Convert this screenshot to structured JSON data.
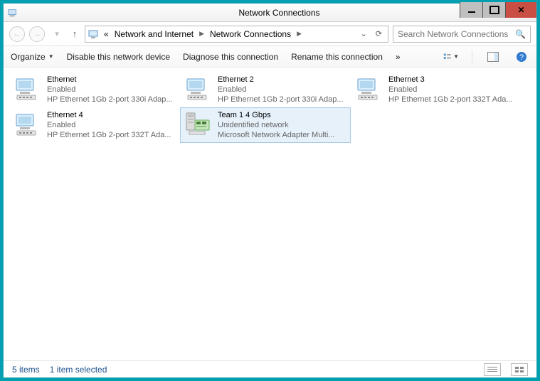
{
  "window": {
    "title": "Network Connections"
  },
  "breadcrumb": {
    "prefix": "«",
    "parts": [
      "Network and Internet",
      "Network Connections"
    ]
  },
  "search": {
    "placeholder": "Search Network Connections"
  },
  "toolbar": {
    "organize": "Organize",
    "disable": "Disable this network device",
    "diagnose": "Diagnose this connection",
    "rename": "Rename this connection",
    "more": "»"
  },
  "items": [
    {
      "name": "Ethernet",
      "status": "Enabled",
      "desc": "HP Ethernet 1Gb 2-port 330i Adap...",
      "selected": false,
      "type": "nic"
    },
    {
      "name": "Ethernet 2",
      "status": "Enabled",
      "desc": "HP Ethernet 1Gb 2-port 330i Adap...",
      "selected": false,
      "type": "nic"
    },
    {
      "name": "Ethernet 3",
      "status": "Enabled",
      "desc": "HP Ethernet 1Gb 2-port 332T Ada...",
      "selected": false,
      "type": "nic"
    },
    {
      "name": "Ethernet 4",
      "status": "Enabled",
      "desc": "HP Ethernet 1Gb 2-port 332T Ada...",
      "selected": false,
      "type": "nic"
    },
    {
      "name": "Team 1 4 Gbps",
      "status": "Unidentified network",
      "desc": "Microsoft Network Adapter Multi...",
      "selected": true,
      "type": "team"
    }
  ],
  "status": {
    "count": "5 items",
    "selection": "1 item selected"
  }
}
